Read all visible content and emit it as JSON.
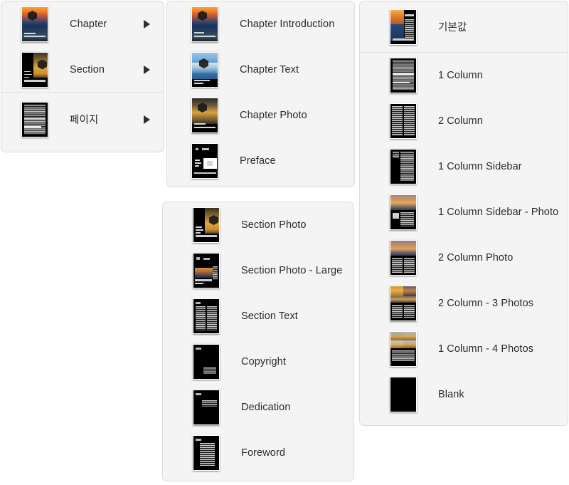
{
  "window": {
    "background_color": "#ffffff",
    "panel_background": "#f4f4f4",
    "panel_border": "#dcdcdc",
    "text_color": "#2b2b2b",
    "arrow_color": "#2f2f2f"
  },
  "panels": [
    {
      "id": "root-menu",
      "name": "root-category-menu",
      "items": [
        {
          "label": "Chapter",
          "icon": "chapter-thumbnail",
          "has_submenu": true,
          "arrow": "▶",
          "divider_below": false
        },
        {
          "label": "Section",
          "icon": "section-thumbnail",
          "has_submenu": true,
          "arrow": "▶",
          "divider_below": true
        },
        {
          "label": "페이지",
          "icon": "page-thumbnail",
          "has_submenu": true,
          "arrow": "▶",
          "divider_below": false
        }
      ]
    },
    {
      "id": "chapter-menu",
      "name": "chapter-submenu",
      "items": [
        {
          "label": "Chapter Introduction",
          "icon": "chapter-introduction-thumbnail"
        },
        {
          "label": "Chapter Text",
          "icon": "chapter-text-thumbnail"
        },
        {
          "label": "Chapter Photo",
          "icon": "chapter-photo-thumbnail"
        },
        {
          "label": "Preface",
          "icon": "preface-thumbnail"
        }
      ]
    },
    {
      "id": "section-menu",
      "name": "section-submenu",
      "items": [
        {
          "label": "Section Photo",
          "icon": "section-photo-thumbnail"
        },
        {
          "label": "Section Photo - Large",
          "icon": "section-photo-large-thumbnail"
        },
        {
          "label": "Section Text",
          "icon": "section-text-thumbnail"
        },
        {
          "label": "Copyright",
          "icon": "copyright-thumbnail"
        },
        {
          "label": "Dedication",
          "icon": "dedication-thumbnail"
        },
        {
          "label": "Foreword",
          "icon": "foreword-thumbnail"
        }
      ]
    },
    {
      "id": "page-menu",
      "name": "page-submenu",
      "items": [
        {
          "label": "기본값",
          "icon": "default-page-thumbnail",
          "divider_below": true
        },
        {
          "label": "1 Column",
          "icon": "one-column-thumbnail"
        },
        {
          "label": "2 Column",
          "icon": "two-column-thumbnail"
        },
        {
          "label": "1 Column Sidebar",
          "icon": "one-column-sidebar-thumbnail"
        },
        {
          "label": "1 Column Sidebar - Photo",
          "icon": "one-column-sidebar-photo-thumbnail"
        },
        {
          "label": "2 Column Photo",
          "icon": "two-column-photo-thumbnail"
        },
        {
          "label": "2 Column - 3 Photos",
          "icon": "two-column-three-photos-thumbnail"
        },
        {
          "label": "1 Column - 4 Photos",
          "icon": "one-column-four-photos-thumbnail"
        },
        {
          "label": "Blank",
          "icon": "blank-page-thumbnail"
        }
      ]
    }
  ]
}
